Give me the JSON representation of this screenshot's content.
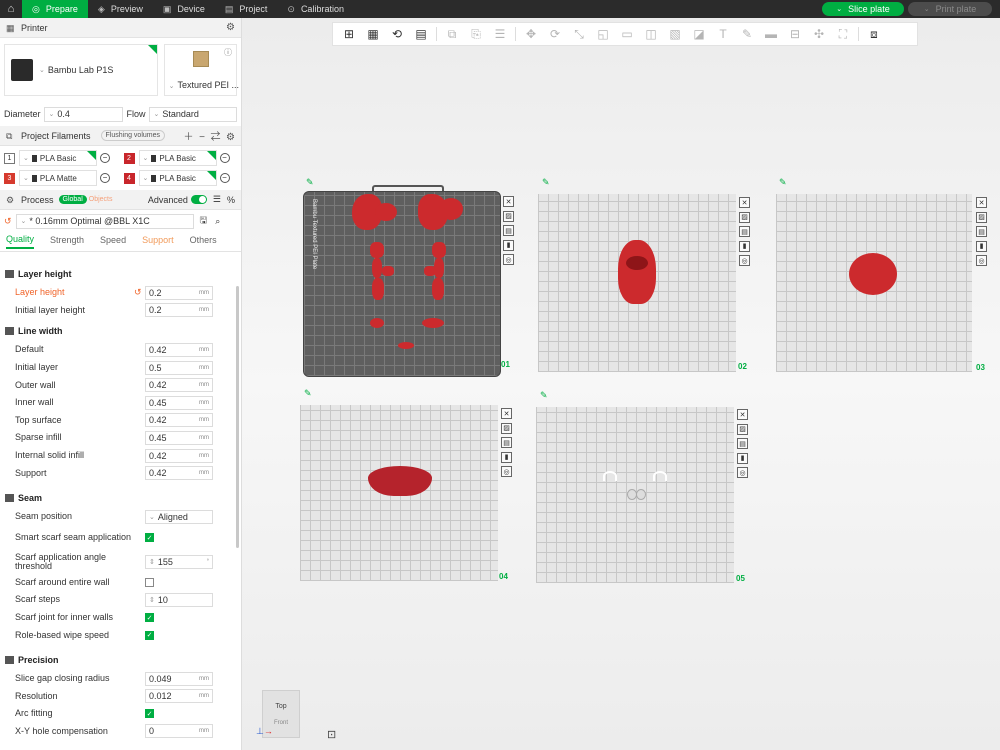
{
  "topbar": {
    "tabs": [
      {
        "label": "Prepare",
        "icon": "prepare-icon"
      },
      {
        "label": "Preview",
        "icon": "preview-icon"
      },
      {
        "label": "Device",
        "icon": "device-icon"
      },
      {
        "label": "Project",
        "icon": "project-icon"
      },
      {
        "label": "Calibration",
        "icon": "calibration-icon"
      }
    ],
    "slice_label": "Slice plate",
    "print_label": "Print plate"
  },
  "printer": {
    "section_title": "Printer",
    "name": "Bambu Lab P1S",
    "plate_type": "Textured PEI ...",
    "diameter_label": "Diameter",
    "diameter_value": "0.4",
    "flow_label": "Flow",
    "flow_value": "Standard"
  },
  "filaments": {
    "section_title": "Project Filaments",
    "flushing_label": "Flushing volumes",
    "items": [
      {
        "num": "1",
        "name": "PLA Basic",
        "color": "#ffffff"
      },
      {
        "num": "2",
        "name": "PLA Basic",
        "color": "#c8262b"
      },
      {
        "num": "3",
        "name": "PLA Matte",
        "color": "#d63a2e"
      },
      {
        "num": "4",
        "name": "PLA Basic",
        "color": "#c8262b"
      }
    ]
  },
  "process": {
    "section_title": "Process",
    "global_label": "Global",
    "objects_label": "Objects",
    "advanced_label": "Advanced",
    "preset": "* 0.16mm Optimal @BBL X1C",
    "tabs": [
      "Quality",
      "Strength",
      "Speed",
      "Support",
      "Others"
    ]
  },
  "settings": {
    "layer_height": {
      "title": "Layer height",
      "rows": [
        {
          "label": "Layer height",
          "value": "0.2",
          "unit": "mm"
        },
        {
          "label": "Initial layer height",
          "value": "0.2",
          "unit": "mm"
        }
      ]
    },
    "line_width": {
      "title": "Line width",
      "rows": [
        {
          "label": "Default",
          "value": "0.42",
          "unit": "mm"
        },
        {
          "label": "Initial layer",
          "value": "0.5",
          "unit": "mm"
        },
        {
          "label": "Outer wall",
          "value": "0.42",
          "unit": "mm"
        },
        {
          "label": "Inner wall",
          "value": "0.45",
          "unit": "mm"
        },
        {
          "label": "Top surface",
          "value": "0.42",
          "unit": "mm"
        },
        {
          "label": "Sparse infill",
          "value": "0.45",
          "unit": "mm"
        },
        {
          "label": "Internal solid infill",
          "value": "0.42",
          "unit": "mm"
        },
        {
          "label": "Support",
          "value": "0.42",
          "unit": "mm"
        }
      ]
    },
    "seam": {
      "title": "Seam",
      "position_label": "Seam position",
      "position_value": "Aligned",
      "smart_scarf_label": "Smart scarf seam application",
      "angle_label": "Scarf application angle threshold",
      "angle_value": "155",
      "entire_wall_label": "Scarf around entire wall",
      "steps_label": "Scarf steps",
      "steps_value": "10",
      "inner_walls_label": "Scarf joint for inner walls",
      "wipe_label": "Role-based wipe speed"
    },
    "precision": {
      "title": "Precision",
      "rows": [
        {
          "label": "Slice gap closing radius",
          "value": "0.049",
          "unit": "mm"
        },
        {
          "label": "Resolution",
          "value": "0.012",
          "unit": "mm"
        }
      ],
      "arc_label": "Arc fitting",
      "xy_hole_label": "X-Y hole compensation",
      "xy_hole_value": "0",
      "xy_hole_unit": "mm"
    }
  },
  "plates": [
    {
      "num": "01"
    },
    {
      "num": "02"
    },
    {
      "num": "03"
    },
    {
      "num": "04"
    },
    {
      "num": "05"
    }
  ],
  "active_plate_text": "Bambu Textured PEI Plate",
  "viewcube_label": "Top",
  "viewcube_sub": "Front"
}
